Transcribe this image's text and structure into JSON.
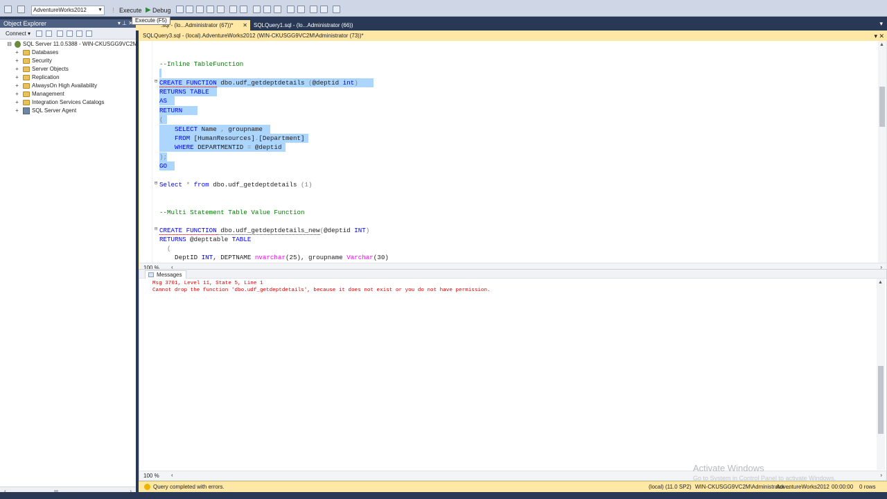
{
  "toolbar": {
    "database": "AdventureWorks2012",
    "execute_label": "Execute",
    "debug_label": "Debug",
    "tooltip": "Execute (F5)"
  },
  "object_explorer": {
    "title": "Object Explorer",
    "connect_label": "Connect ▾",
    "server": "SQL Server 11.0.5388 - WIN-CKUSGG9VC2M",
    "nodes": [
      "Databases",
      "Security",
      "Server Objects",
      "Replication",
      "AlwaysOn High Availability",
      "Management",
      "Integration Services Catalogs",
      "SQL Server Agent"
    ]
  },
  "tabs": [
    {
      "label": ".sql - (lo...Administrator (67))*"
    },
    {
      "label": "SQLQuery1.sql - (lo...Administrator (66))"
    }
  ],
  "document": {
    "title": "SQLQuery3.sql - (local).AdventureWorks2012 (WIN-CKUSGG9VC2M\\Administrator (73))*",
    "zoom": "100 %"
  },
  "code": {
    "l1": "--Inline TableFunction",
    "l2a": "CREATE FUNCTION",
    "l2b": " dbo.udf_getdeptdetails ",
    "l2c": "(",
    "l2d": "@deptid",
    "l2e": " int",
    "l2f": ")",
    "l3a": "RETURNS",
    "l3b": " TABLE",
    "l4": "AS",
    "l5": "RETURN",
    "l6": "(",
    "l7a": "    SELECT",
    "l7b": " Name ",
    "l7c": ",",
    "l7d": " groupname",
    "l8a": "    FROM",
    "l8b": " [HumanResources]",
    "l8c": ".",
    "l8d": "[Department]",
    "l9a": "    WHERE",
    "l9b": " DEPARTMENTID ",
    "l9c": "=",
    "l9d": " @deptid",
    "l10": ");",
    "l11": "GO",
    "l12a": "Select",
    "l12b": " * ",
    "l12c": "from",
    "l12d": " dbo.udf_getdeptdetails ",
    "l12e": "(1)",
    "l13": "--Multi Statement Table Value Function",
    "l14a": "CREATE FUNCTION",
    "l14b": " dbo.udf_getdeptdetails_new",
    "l14c": "(",
    "l14d": "@deptid",
    "l14e": " INT",
    "l14f": ")",
    "l15a": "RETURNS",
    "l15b": " @depttable ",
    "l15c": "TABLE",
    "l16": "  (",
    "l17a": "    DeptID ",
    "l17b": "INT",
    "l17c": ", DEPTNAME ",
    "l17d": "nvarchar",
    "l17e": "(25), groupname ",
    "l17f": "Varchar",
    "l17g": "(30)"
  },
  "messages": {
    "tab_label": "Messages",
    "line1": "Msg 3701, Level 11, State 5, Line 1",
    "line2": "Cannot drop the function 'dbo.udf_getdeptdetails', because it does not exist or you do not have permission.",
    "zoom": "100 %"
  },
  "watermark": {
    "line1": "Activate Windows",
    "line2": "Go to System in Control Panel to activate Windows."
  },
  "status": {
    "text": "Query completed with errors.",
    "server": "(local) (11.0 SP2)",
    "user": "WIN-CKUSGG9VC2M\\Administrator ...",
    "database": "AdventureWorks2012",
    "time": "00:00:00",
    "rows": "0 rows"
  },
  "colors": {
    "chrome": "#293955",
    "tab_active": "#ffe8a6",
    "selection": "#add6ff",
    "keyword": "#0000ff",
    "comment": "#008000",
    "error": "#d80000"
  }
}
